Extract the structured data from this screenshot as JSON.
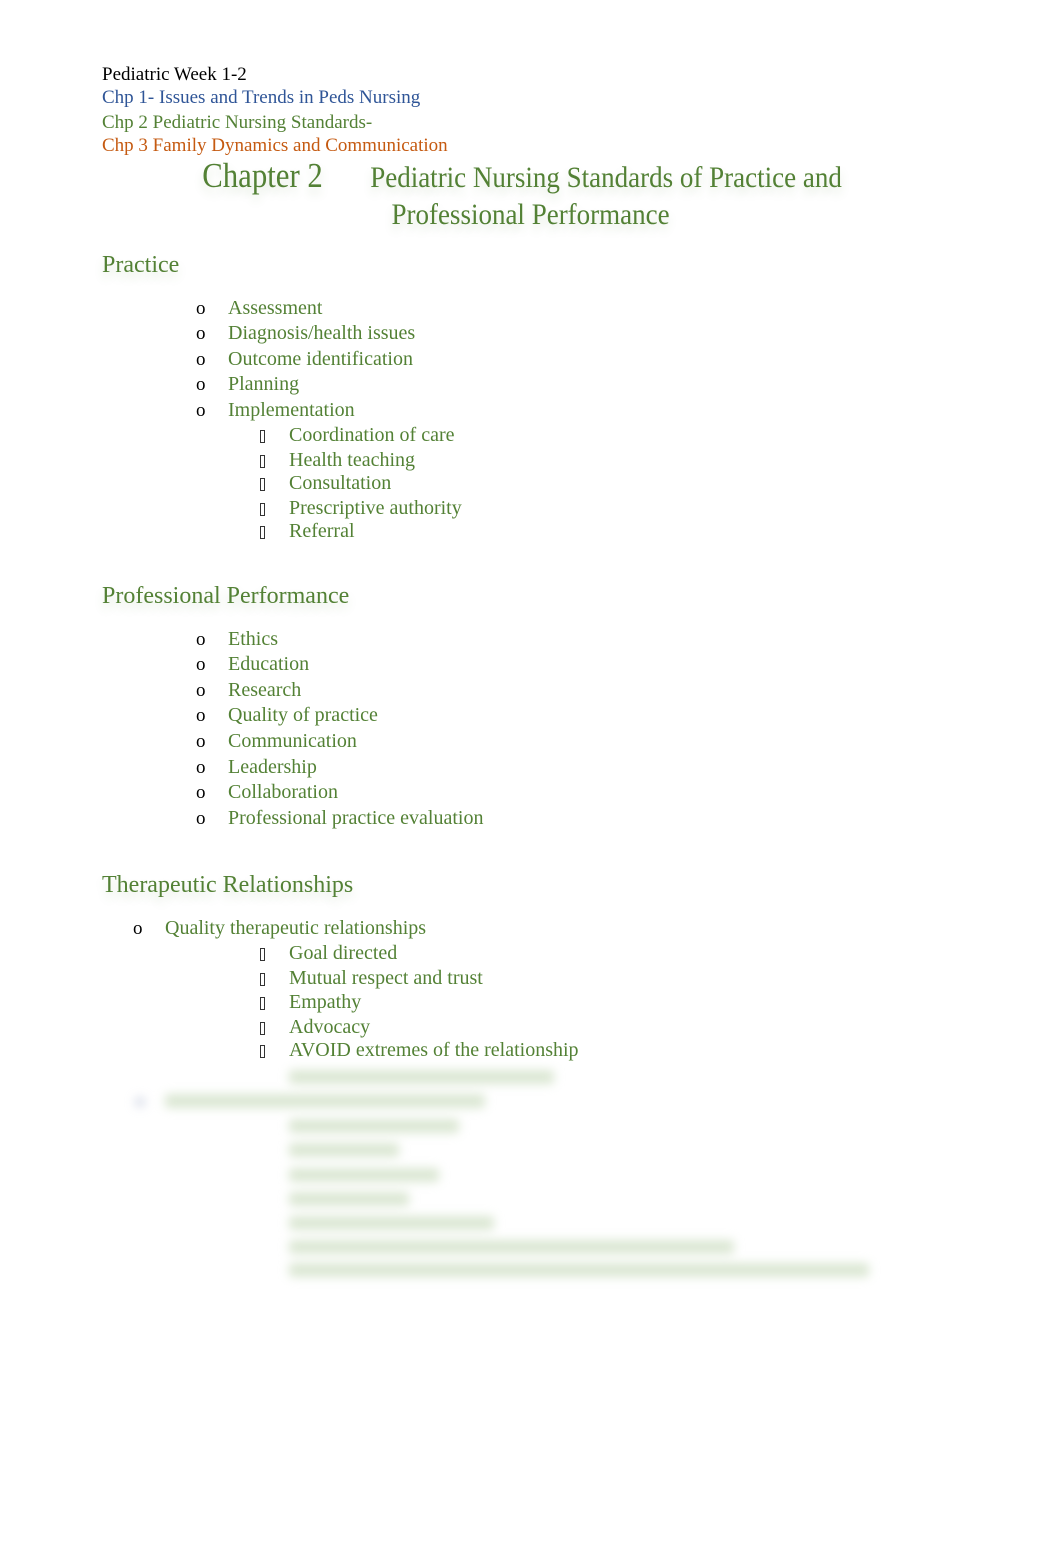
{
  "header": {
    "week": "Pediatric Week 1-2",
    "chapters": [
      {
        "label": "Chp 1- Issues and Trends in Peds Nursing",
        "color": "#2F5597"
      },
      {
        "label": "Chp 2 Pediatric Nursing Standards-",
        "color": "#538135"
      },
      {
        "label": "Chp 3 Family Dynamics and Communication",
        "color": "#C55A11"
      }
    ]
  },
  "title": {
    "chapter": "Chapter 2",
    "line1": "Pediatric Nursing Standards of Practice and",
    "line2": "Professional Performance"
  },
  "sections": {
    "practice": {
      "heading": "Practice",
      "items": [
        "Assessment",
        "Diagnosis/health issues",
        "Outcome identification",
        "Planning",
        "Implementation"
      ],
      "implementation_subitems": [
        "Coordination of care",
        "Health teaching",
        "Consultation",
        "Prescriptive authority",
        "Referral"
      ]
    },
    "professional_performance": {
      "heading": "Professional Performance",
      "items": [
        "Ethics",
        "Education",
        "Research",
        "Quality of practice",
        "Communication",
        "Leadership",
        "Collaboration",
        "Professional practice evaluation"
      ]
    },
    "therapeutic_relationships": {
      "heading": "Therapeutic Relationships",
      "items": [
        "Quality therapeutic relationships"
      ],
      "subitems": [
        "Goal directed",
        "Mutual respect and trust",
        "Empathy",
        "Advocacy",
        "AVOID extremes of the relationship"
      ]
    }
  },
  "bullets": {
    "level1": "o"
  },
  "icons": {
    "level1_bullet": "hollow-circle-bullet",
    "level2_bullet": "missing-glyph-square-bullet"
  },
  "colors": {
    "text_black": "#000000",
    "accent_green": "#538135",
    "accent_blue": "#2F5597",
    "accent_orange": "#C55A11"
  }
}
